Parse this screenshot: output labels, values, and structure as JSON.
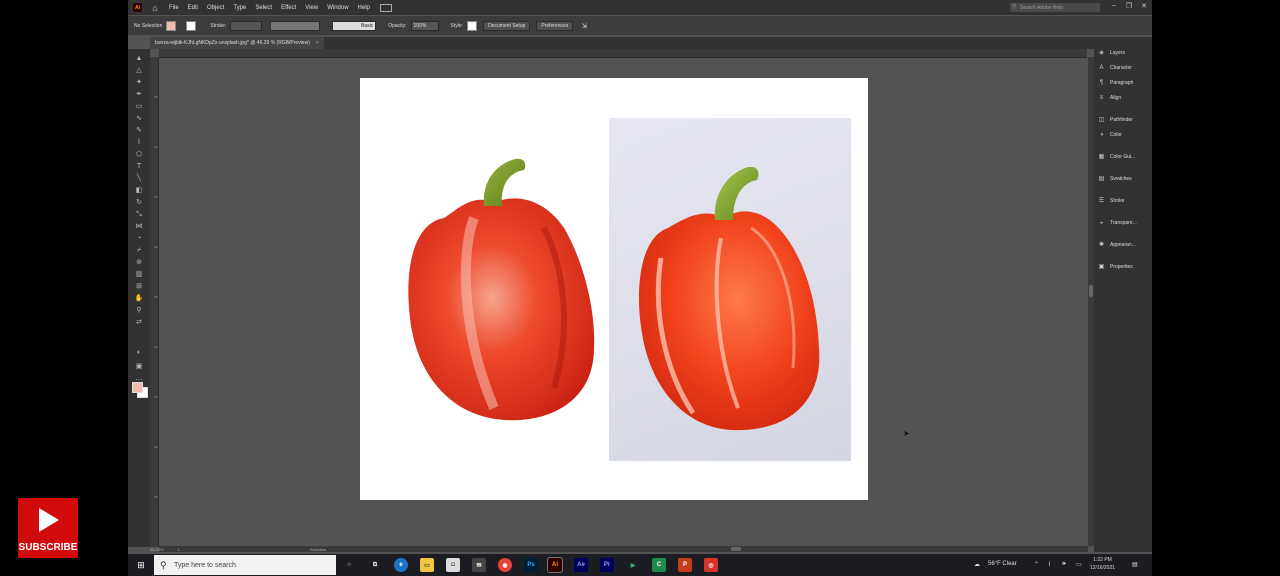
{
  "menubar": {
    "app_logo": "Ai",
    "items": [
      "File",
      "Edit",
      "Object",
      "Type",
      "Select",
      "Effect",
      "View",
      "Window",
      "Help"
    ],
    "search_placeholder": "Search Adobe Help"
  },
  "control_bar": {
    "selection_label": "No Selection",
    "stroke_label": "Stroke:",
    "brush_label": "Basic",
    "opacity_label": "Opacity:",
    "opacity_value": "100%",
    "style_label": "Style:",
    "document_setup": "Document Setup",
    "preferences": "Preferences"
  },
  "document": {
    "tab_title": "bonza-wijbik-KJhLgNKDpZs-unsplash.jpg* @ 46.29 % (RGB/Preview)",
    "tab_close": "×"
  },
  "statusbar": {
    "zoom": "46.29%",
    "page": "1",
    "tool": "Selection"
  },
  "panels": [
    {
      "icon": "layers-icon",
      "label": "Layers"
    },
    {
      "icon": "character-icon",
      "label": "Character"
    },
    {
      "icon": "paragraph-icon",
      "label": "Paragraph"
    },
    {
      "icon": "align-icon",
      "label": "Align"
    },
    {
      "icon": "pathfinder-icon",
      "label": "Pathfinder"
    },
    {
      "icon": "color-icon",
      "label": "Color"
    },
    {
      "icon": "color-guide-icon",
      "label": "Color Gui..."
    },
    {
      "icon": "swatches-icon",
      "label": "Swatches"
    },
    {
      "icon": "stroke-icon",
      "label": "Stroke"
    },
    {
      "icon": "transparency-icon",
      "label": "Transpare..."
    },
    {
      "icon": "appearance-icon",
      "label": "Appearan..."
    },
    {
      "icon": "properties-icon",
      "label": "Properties"
    }
  ],
  "taskbar": {
    "search_placeholder": "Type here to search",
    "weather": "56°F  Clear",
    "time": "1:22 PM",
    "date": "12/16/2021"
  },
  "overlay": {
    "subscribe_label": "SUBSCRIBE"
  },
  "colors": {
    "fill_color": "#f2b9b0",
    "pepper_red": "#e8321c",
    "stem_green": "#7a9a2a",
    "subscribe_red": "#d10b0b"
  }
}
